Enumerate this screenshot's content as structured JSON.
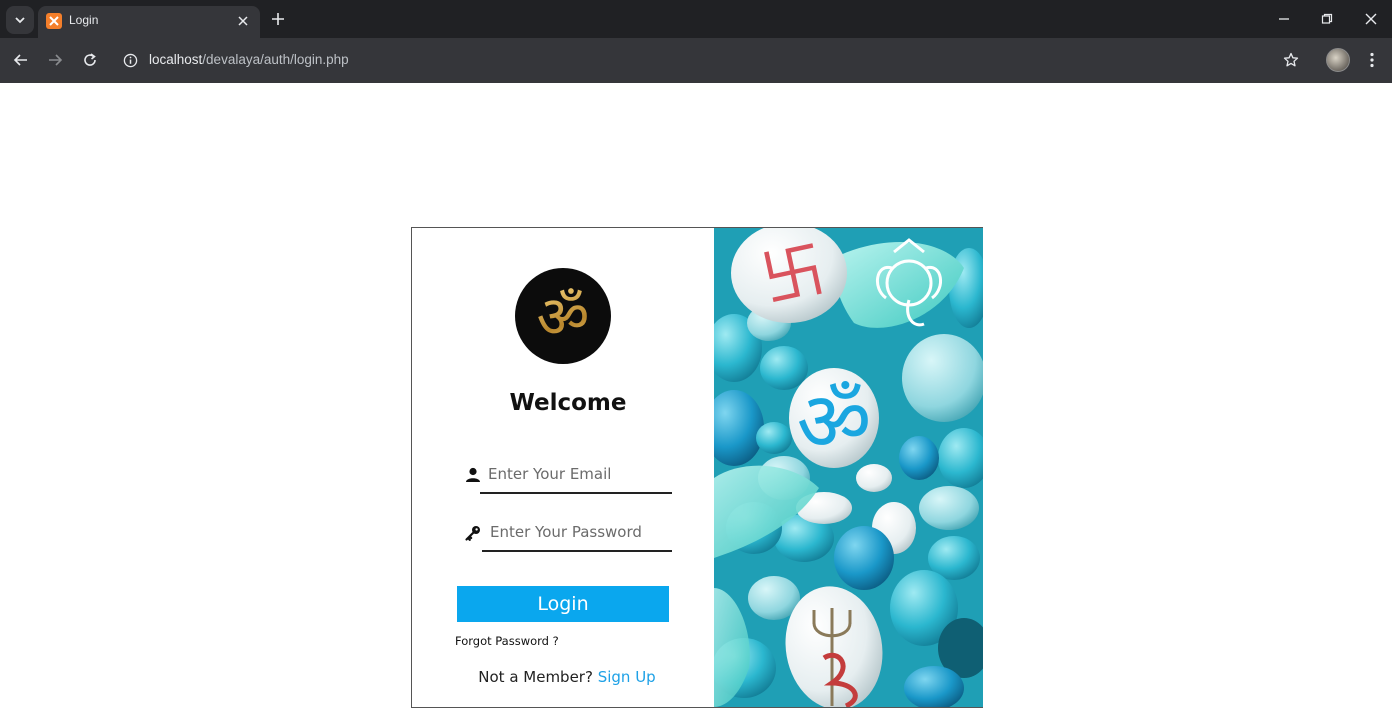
{
  "browser": {
    "tab_title": "Login",
    "url_host": "localhost",
    "url_path": "/devalaya/auth/login.php"
  },
  "login": {
    "logo_glyph": "ॐ",
    "heading": "Welcome",
    "email_placeholder": "Enter Your Email",
    "email_value": "",
    "password_placeholder": "Enter Your Password",
    "password_value": "",
    "login_button": "Login",
    "forgot_password": "Forgot Password ?",
    "not_member": "Not a Member?",
    "sign_up": "Sign Up"
  },
  "art": {
    "om_glyph": "ॐ",
    "swastika_glyph": "卐"
  },
  "colors": {
    "accent": "#0aa7ee",
    "link": "#1ea1e6"
  }
}
